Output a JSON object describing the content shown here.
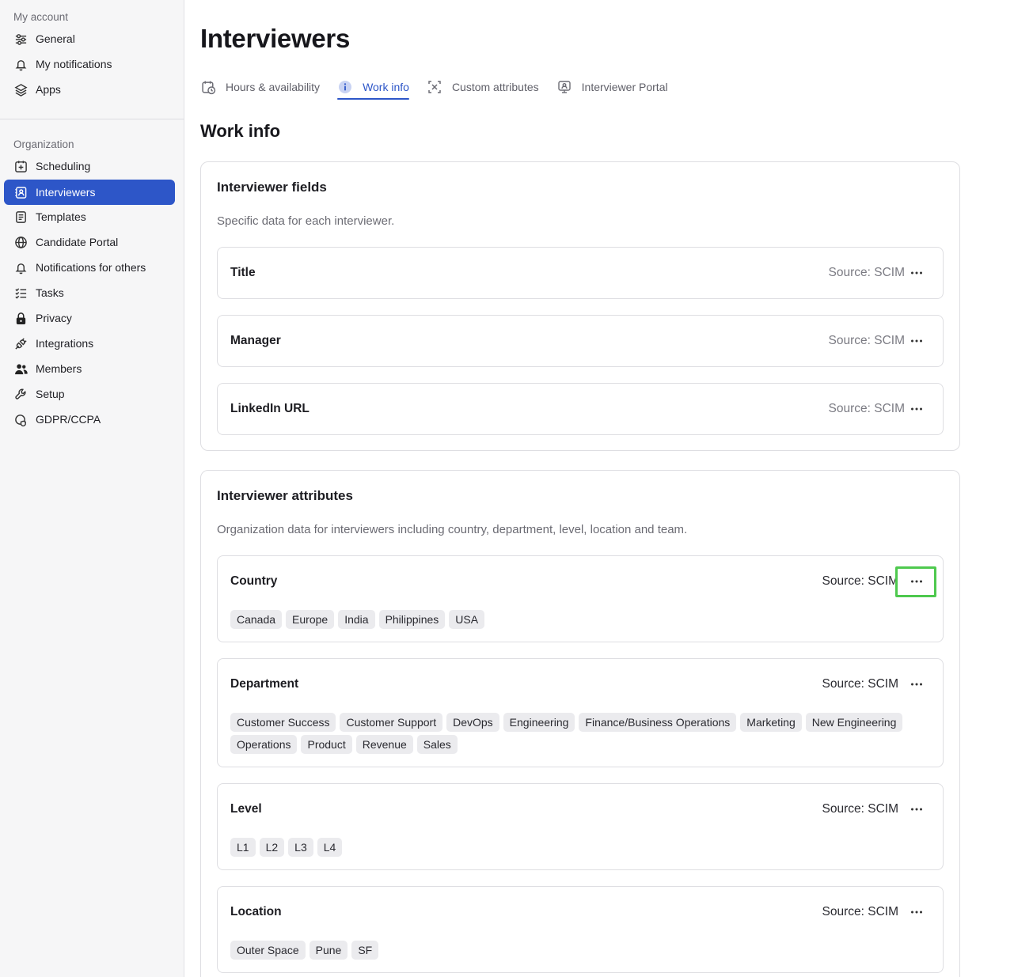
{
  "sidebar": {
    "my_account_title": "My account",
    "my_account_items": [
      {
        "label": "General",
        "icon": "sliders-icon"
      },
      {
        "label": "My notifications",
        "icon": "bell-icon"
      },
      {
        "label": "Apps",
        "icon": "layers-icon"
      }
    ],
    "organization_title": "Organization",
    "organization_items": [
      {
        "label": "Scheduling",
        "icon": "calendar-plus-icon"
      },
      {
        "label": "Interviewers",
        "icon": "contacts-book-icon",
        "active": true
      },
      {
        "label": "Templates",
        "icon": "template-icon"
      },
      {
        "label": "Candidate Portal",
        "icon": "globe-icon"
      },
      {
        "label": "Notifications for others",
        "icon": "bell-icon"
      },
      {
        "label": "Tasks",
        "icon": "checklist-icon"
      },
      {
        "label": "Privacy",
        "icon": "lock-icon"
      },
      {
        "label": "Integrations",
        "icon": "plug-icon"
      },
      {
        "label": "Members",
        "icon": "users-icon"
      },
      {
        "label": "Setup",
        "icon": "wrench-icon"
      },
      {
        "label": "GDPR/CCPA",
        "icon": "shield-icon"
      }
    ]
  },
  "main": {
    "title": "Interviewers",
    "tabs": [
      {
        "label": "Hours & availability",
        "icon": "calendar-clock-icon"
      },
      {
        "label": "Work info",
        "icon": "info-icon",
        "active": true
      },
      {
        "label": "Custom attributes",
        "icon": "attributes-icon"
      },
      {
        "label": "Interviewer Portal",
        "icon": "portal-icon"
      }
    ],
    "section_title": "Work info",
    "fields_card": {
      "title": "Interviewer fields",
      "description": "Specific data for each interviewer.",
      "rows": [
        {
          "label": "Title",
          "source": "Source: SCIM"
        },
        {
          "label": "Manager",
          "source": "Source: SCIM"
        },
        {
          "label": "LinkedIn URL",
          "source": "Source: SCIM"
        }
      ]
    },
    "attributes_card": {
      "title": "Interviewer attributes",
      "description": "Organization data for interviewers including country, department, level, location and team.",
      "rows": [
        {
          "label": "Country",
          "source": "Source: SCIM",
          "values": [
            "Canada",
            "Europe",
            "India",
            "Philippines",
            "USA"
          ]
        },
        {
          "label": "Department",
          "source": "Source: SCIM",
          "values": [
            "Customer Success",
            "Customer Support",
            "DevOps",
            "Engineering",
            "Finance/Business Operations",
            "Marketing",
            "New Engineering",
            "Operations",
            "Product",
            "Revenue",
            "Sales"
          ]
        },
        {
          "label": "Level",
          "source": "Source: SCIM",
          "values": [
            "L1",
            "L2",
            "L3",
            "L4"
          ]
        },
        {
          "label": "Location",
          "source": "Source: SCIM",
          "values": [
            "Outer Space",
            "Pune",
            "SF"
          ]
        }
      ]
    }
  },
  "colors": {
    "accent": "#2d56c8",
    "highlight_box": "#4ec94e",
    "chip_bg": "#ebebee"
  }
}
